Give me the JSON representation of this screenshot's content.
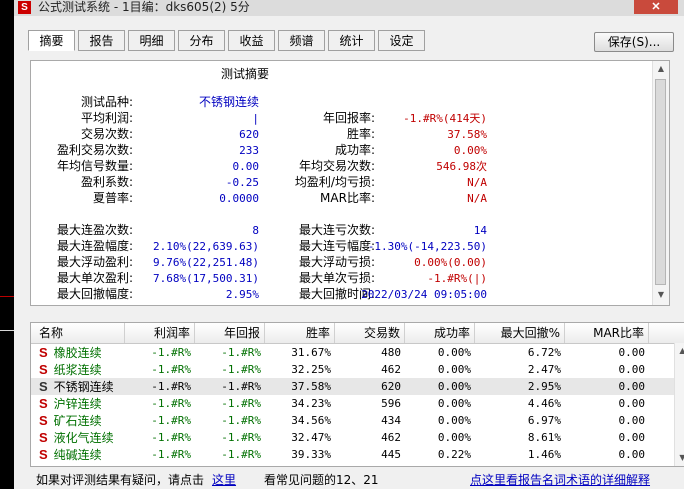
{
  "window": {
    "icon_letter": "S",
    "title": "公式测试系统 - 1目编：dks605(2) 5分",
    "close_label": "✕"
  },
  "tabs": [
    "摘要",
    "报告",
    "明细",
    "分布",
    "收益",
    "频谱",
    "统计",
    "设定"
  ],
  "active_tab": "摘要",
  "save_button": "保存(S)...",
  "summary": {
    "heading": "测试摘要",
    "rows": [
      {
        "label": "测试品种:",
        "value": "不锈钢连续"
      },
      {
        "label": "平均利润:",
        "value": "|",
        "label2": "年回报率:",
        "value2": "-1.#R%(414天)"
      },
      {
        "label": "交易次数:",
        "value": "620",
        "label2": "胜率:",
        "value2": "37.58%"
      },
      {
        "label": "盈利交易次数:",
        "value": "233",
        "label2": "成功率:",
        "value2": "0.00%"
      },
      {
        "label": "年均信号数量:",
        "value": "0.00",
        "label2": "年均交易次数:",
        "value2": "546.98次"
      },
      {
        "label": "盈利系数:",
        "value": "-0.25",
        "label2": "均盈利/均亏损:",
        "value2": "N/A"
      },
      {
        "label": "夏普率:",
        "value": "0.0000",
        "label2": "MAR比率:",
        "value2": "N/A"
      },
      {
        "label": "最大连盈次数:",
        "value": "8",
        "label2": "最大连亏次数:",
        "value2": "14"
      },
      {
        "label": "最大连盈幅度:",
        "value": "2.10%(22,639.63)",
        "label2": "最大连亏幅度:",
        "value2": "-1.30%(-14,223.50)"
      },
      {
        "label": "最大浮动盈利:",
        "value": "9.76%(22,251.48)",
        "label2": "最大浮动亏损:",
        "value2": "0.00%(0.00)"
      },
      {
        "label": "最大单次盈利:",
        "value": "7.68%(17,500.31)",
        "label2": "最大单次亏损:",
        "value2": "-1.#R%(|)"
      },
      {
        "label": "最大回撤幅度:",
        "value": "2.95%",
        "label2": "最大回撤时间:",
        "value2": "2022/03/24 09:05:00"
      }
    ]
  },
  "table": {
    "columns": [
      "名称",
      "利润率",
      "年回报",
      "胜率",
      "交易数",
      "成功率",
      "最大回撤%",
      "MAR比率"
    ],
    "rows": [
      {
        "badge": "S",
        "cells": [
          "橡胶连续",
          "-1.#R%",
          "-1.#R%",
          "31.67%",
          "480",
          "0.00%",
          "6.72%",
          "0.00"
        ]
      },
      {
        "badge": "S",
        "cells": [
          "纸浆连续",
          "-1.#R%",
          "-1.#R%",
          "32.25%",
          "462",
          "0.00%",
          "2.47%",
          "0.00"
        ]
      },
      {
        "badge": "S",
        "cells": [
          "不锈钢连续",
          "-1.#R%",
          "-1.#R%",
          "37.58%",
          "620",
          "0.00%",
          "2.95%",
          "0.00"
        ]
      },
      {
        "badge": "S",
        "cells": [
          "沪锌连续",
          "-1.#R%",
          "-1.#R%",
          "34.23%",
          "596",
          "0.00%",
          "4.46%",
          "0.00"
        ]
      },
      {
        "badge": "S",
        "cells": [
          "矿石连续",
          "-1.#R%",
          "-1.#R%",
          "34.56%",
          "434",
          "0.00%",
          "6.97%",
          "0.00"
        ]
      },
      {
        "badge": "S",
        "cells": [
          "液化气连续",
          "-1.#R%",
          "-1.#R%",
          "32.47%",
          "462",
          "0.00%",
          "8.61%",
          "0.00"
        ]
      },
      {
        "badge": "S",
        "cells": [
          "纯碱连续",
          "-1.#R%",
          "-1.#R%",
          "39.33%",
          "445",
          "0.22%",
          "1.46%",
          "0.00"
        ]
      }
    ],
    "selected_row": 2
  },
  "footer": {
    "question": "如果对评测结果有疑问，请点击",
    "here_link": "这里",
    "faq": "看常见问题的12、21",
    "detail_link": "点这里看报告名词术语的详细解释"
  },
  "colors": {
    "value_blue": "#0000c0",
    "value_red": "#c00000",
    "badge_red": "#c00000",
    "green": "#007000"
  }
}
